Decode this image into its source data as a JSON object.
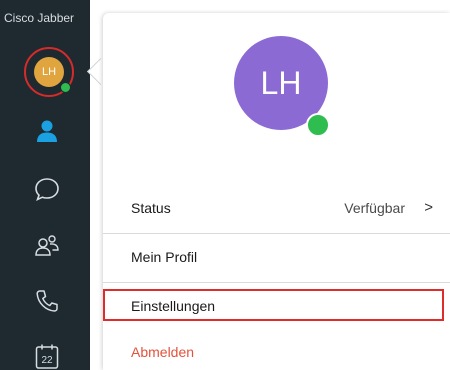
{
  "app": {
    "title": "Cisco Jabber"
  },
  "user": {
    "initials": "LH",
    "status_color": "#2ebd4e",
    "small_avatar_color": "#e0a53e",
    "large_avatar_color": "#8c6ad4"
  },
  "sidebar": {
    "items": [
      {
        "name": "contacts",
        "icon": "person-icon",
        "active": true
      },
      {
        "name": "chats",
        "icon": "chat-bubble-icon",
        "active": false
      },
      {
        "name": "meetings",
        "icon": "people-icon",
        "active": false
      },
      {
        "name": "calls",
        "icon": "phone-icon",
        "active": false
      },
      {
        "name": "calendar",
        "icon": "calendar-icon",
        "active": false,
        "label": "22"
      }
    ]
  },
  "menu": {
    "status_label": "Status",
    "status_value": "Verfügbar",
    "status_chevron": ">",
    "profile_label": "Mein Profil",
    "settings_label": "Einstellungen",
    "logout_label": "Abmelden"
  },
  "colors": {
    "sidebar_bg": "#1e2a30",
    "active_icon": "#1ba0e2",
    "highlight": "#e02b2b",
    "logout_text": "#e2533c"
  }
}
